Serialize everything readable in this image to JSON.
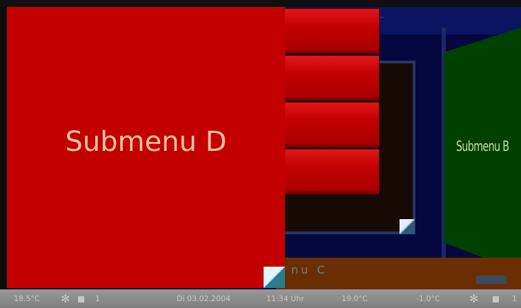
{
  "menu": {
    "submenu_d": "Submenu D",
    "submenu_b": "Submenu B",
    "submenu_c": "nu C"
  },
  "ceiling": {
    "text": "~",
    "corner": "—"
  },
  "status": {
    "temp_left": "18.5°C",
    "num_left": "1",
    "date": "Di 03.02.2004",
    "time": "11:34 Uhr",
    "temp_mid": "19.0°C",
    "temp_right": "-1.0°C",
    "num_right": "1"
  },
  "colors": {
    "panel_red": "#c30000",
    "panel_green": "#004000",
    "background": "#05083f",
    "floor": "#6a2e00",
    "status_bar": "#8a8a8a"
  }
}
